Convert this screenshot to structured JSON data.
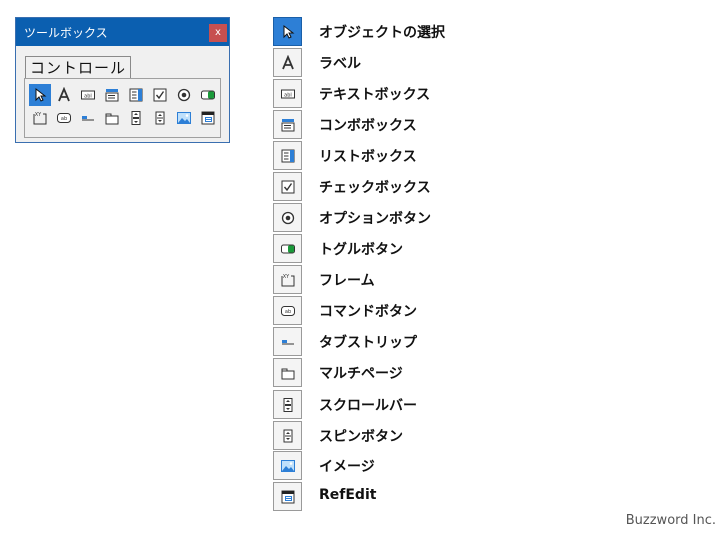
{
  "toolbox": {
    "title": "ツールボックス",
    "close_glyph": "x",
    "tab_label": "コントロール"
  },
  "toolbox_icons": [
    "pointer-icon",
    "label-icon",
    "textbox-icon",
    "combobox-icon",
    "listbox-icon",
    "checkbox-icon",
    "optionbutton-icon",
    "togglebutton-icon",
    "frame-icon",
    "commandbutton-icon",
    "tabstrip-icon",
    "multipage-icon",
    "scrollbar-icon",
    "spinbutton-icon",
    "image-icon",
    "refedit-icon"
  ],
  "legend": [
    {
      "icon": "pointer-icon",
      "label": "オブジェクトの選択"
    },
    {
      "icon": "label-icon",
      "label": "ラベル"
    },
    {
      "icon": "textbox-icon",
      "label": "テキストボックス"
    },
    {
      "icon": "combobox-icon",
      "label": "コンボボックス"
    },
    {
      "icon": "listbox-icon",
      "label": "リストボックス"
    },
    {
      "icon": "checkbox-icon",
      "label": "チェックボックス"
    },
    {
      "icon": "optionbutton-icon",
      "label": "オプションボタン"
    },
    {
      "icon": "togglebutton-icon",
      "label": "トグルボタン"
    },
    {
      "icon": "frame-icon",
      "label": "フレーム"
    },
    {
      "icon": "commandbutton-icon",
      "label": "コマンドボタン"
    },
    {
      "icon": "tabstrip-icon",
      "label": "タブストリップ"
    },
    {
      "icon": "multipage-icon",
      "label": "マルチページ"
    },
    {
      "icon": "scrollbar-icon",
      "label": "スクロールバー"
    },
    {
      "icon": "spinbutton-icon",
      "label": "スピンボタン"
    },
    {
      "icon": "image-icon",
      "label": "イメージ"
    },
    {
      "icon": "refedit-icon",
      "label": "RefEdit"
    }
  ],
  "credit": "Buzzword Inc.",
  "colors": {
    "titlebar": "#0b5fb0",
    "close_button": "#c75050",
    "selected": "#2d7fd6",
    "toggle_green": "#1a9a3a"
  }
}
